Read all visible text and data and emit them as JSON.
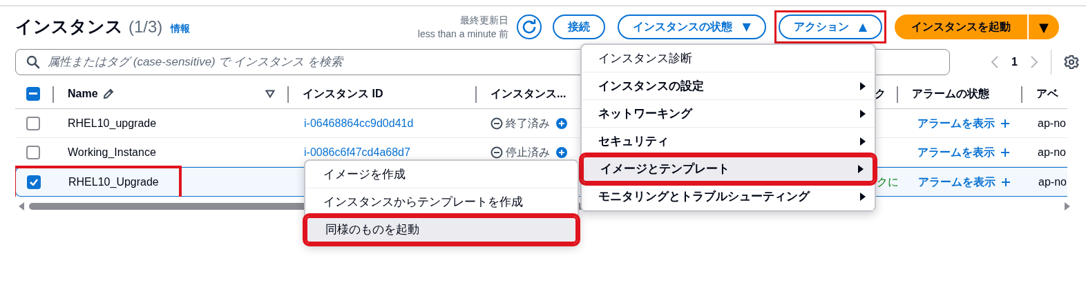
{
  "header": {
    "title": "インスタンス",
    "count": "(1/3)",
    "info_link": "情報",
    "updated_label": "最終更新日",
    "updated_value": "less than a minute 前"
  },
  "buttons": [
    {
      "label": "接続",
      "kind": "plain",
      "highlighted": false
    },
    {
      "label": "インスタンスの状態",
      "kind": "dropdown",
      "caret": "▼",
      "highlighted": false
    },
    {
      "label": "アクション",
      "kind": "dropdown",
      "caret": "▲",
      "highlighted": true
    },
    {
      "label": "インスタンスを起動",
      "kind": "split",
      "caret": "▼",
      "highlighted": false
    }
  ],
  "search": {
    "placeholder": "属性またはタグ (case-sensitive) で インスタンス を検索"
  },
  "pagination": {
    "page": "1",
    "prev_disabled": true,
    "next_disabled": true
  },
  "table": {
    "select_all": {
      "kind": "indeterminate"
    },
    "columns": [
      {
        "label": "Name",
        "kind": "name"
      },
      {
        "label": "インスタンス ID",
        "kind": "text"
      },
      {
        "label": "インスタンス...",
        "kind": "text"
      },
      {
        "label": "ク",
        "kind": "text"
      },
      {
        "label": "アラームの状態",
        "kind": "text"
      },
      {
        "label": "アベ",
        "kind": "text"
      }
    ],
    "rows": [
      {
        "selected": false,
        "highlighted": false,
        "name": "RHEL10_upgrade",
        "instance_id": "i-06468864cc9d0d41d",
        "state": "終了済み",
        "alarm": "アラームを表示",
        "zone": "ap-no"
      },
      {
        "selected": false,
        "highlighted": false,
        "name": "Working_Instance",
        "instance_id": "i-0086c6f47cd4a68d7",
        "state": "停止済み",
        "alarm": "アラームを表示",
        "zone": "ap-no"
      },
      {
        "selected": true,
        "highlighted": true,
        "name": "RHEL10_Upgrade",
        "status_check": "クに",
        "alarm": "アラームを表示",
        "zone": "ap-no"
      }
    ]
  },
  "actions_menu": {
    "items": [
      {
        "label": "インスタンス診断",
        "has_submenu": false,
        "selected": false,
        "highlighted": false
      },
      {
        "label": "インスタンスの設定",
        "has_submenu": true,
        "selected": false,
        "highlighted": false
      },
      {
        "label": "ネットワーキング",
        "has_submenu": true,
        "selected": false,
        "highlighted": false
      },
      {
        "label": "セキュリティ",
        "has_submenu": true,
        "selected": false,
        "highlighted": false
      },
      {
        "label": "イメージとテンプレート",
        "has_submenu": true,
        "selected": true,
        "highlighted": true
      },
      {
        "label": "モニタリングとトラブルシューティング",
        "has_submenu": true,
        "selected": false,
        "highlighted": false
      }
    ]
  },
  "submenu": {
    "items": [
      {
        "label": "イメージを作成",
        "selected": false,
        "highlighted": false
      },
      {
        "label": "インスタンスからテンプレートを作成",
        "selected": false,
        "highlighted": false
      },
      {
        "label": "同様のものを起動",
        "selected": true,
        "highlighted": true
      }
    ]
  }
}
